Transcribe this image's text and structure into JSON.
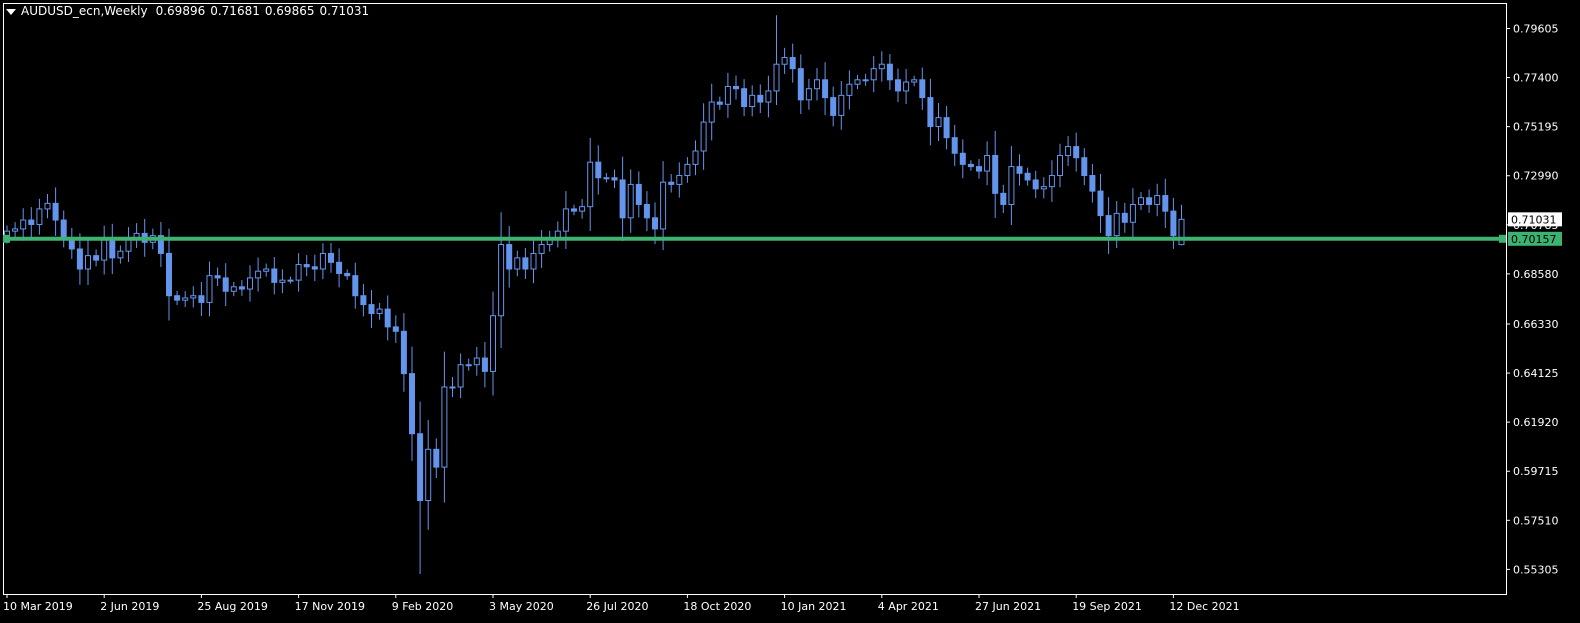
{
  "header": {
    "symbol": "AUDUSD_ecn,Weekly",
    "open": "0.69896",
    "high": "0.71681",
    "low": "0.69865",
    "close": "0.71031"
  },
  "colors": {
    "background": "#000000",
    "axis": "#ffffff",
    "candle": "#6495ed",
    "hline": "#3cb371",
    "price_label_bg": "#ffffff",
    "hline_label_bg": "#3cb371"
  },
  "icons": {
    "menu": "triangle-down-icon"
  },
  "chart_data": {
    "type": "candlestick",
    "title": "AUDUSD_ecn,Weekly",
    "timeframe": "Weekly",
    "ylim": [
      0.542,
      0.8075
    ],
    "y_ticks": [
      "0.79605",
      "0.77400",
      "0.75195",
      "0.72990",
      "0.70785",
      "0.68580",
      "0.66330",
      "0.64125",
      "0.61920",
      "0.59715",
      "0.57510",
      "0.55305"
    ],
    "x_ticks": [
      {
        "label": "10 Mar 2019",
        "bar": 0
      },
      {
        "label": "2 Jun 2019",
        "bar": 12
      },
      {
        "label": "25 Aug 2019",
        "bar": 24
      },
      {
        "label": "17 Nov 2019",
        "bar": 36
      },
      {
        "label": "9 Feb 2020",
        "bar": 48
      },
      {
        "label": "3 May 2020",
        "bar": 60
      },
      {
        "label": "26 Jul 2020",
        "bar": 72
      },
      {
        "label": "18 Oct 2020",
        "bar": 84
      },
      {
        "label": "10 Jan 2021",
        "bar": 96
      },
      {
        "label": "4 Apr 2021",
        "bar": 108
      },
      {
        "label": "27 Jun 2021",
        "bar": 120
      },
      {
        "label": "19 Sep 2021",
        "bar": 132
      },
      {
        "label": "12 Dec 2021",
        "bar": 144
      }
    ],
    "current_price": "0.71031",
    "horizontal_line": "0.70157",
    "closes": [
      0.705,
      0.706,
      0.71,
      0.708,
      0.715,
      0.7175,
      0.71,
      0.702,
      0.697,
      0.688,
      0.694,
      0.692,
      0.701,
      0.693,
      0.696,
      0.702,
      0.704,
      0.7,
      0.703,
      0.695,
      0.676,
      0.674,
      0.675,
      0.676,
      0.673,
      0.685,
      0.684,
      0.678,
      0.68,
      0.679,
      0.684,
      0.687,
      0.688,
      0.682,
      0.683,
      0.683,
      0.69,
      0.689,
      0.688,
      0.695,
      0.691,
      0.686,
      0.685,
      0.676,
      0.672,
      0.668,
      0.67,
      0.662,
      0.66,
      0.641,
      0.614,
      0.584,
      0.607,
      0.599,
      0.635,
      0.635,
      0.645,
      0.645,
      0.648,
      0.642,
      0.667,
      0.699,
      0.688,
      0.693,
      0.688,
      0.695,
      0.699,
      0.702,
      0.705,
      0.715,
      0.714,
      0.716,
      0.736,
      0.729,
      0.729,
      0.728,
      0.711,
      0.726,
      0.717,
      0.711,
      0.706,
      0.727,
      0.726,
      0.73,
      0.735,
      0.741,
      0.754,
      0.763,
      0.762,
      0.77,
      0.769,
      0.761,
      0.766,
      0.763,
      0.768,
      0.78,
      0.783,
      0.778,
      0.764,
      0.769,
      0.773,
      0.765,
      0.757,
      0.766,
      0.771,
      0.773,
      0.773,
      0.778,
      0.78,
      0.773,
      0.768,
      0.772,
      0.773,
      0.765,
      0.752,
      0.756,
      0.747,
      0.74,
      0.735,
      0.734,
      0.732,
      0.739,
      0.722,
      0.717,
      0.734,
      0.731,
      0.728,
      0.724,
      0.725,
      0.73,
      0.739,
      0.743,
      0.738,
      0.73,
      0.723,
      0.712,
      0.703,
      0.713,
      0.709,
      0.717,
      0.72,
      0.717,
      0.721,
      0.714,
      0.703,
      0.7103
    ],
    "last_bar": {
      "open": 0.69896,
      "high": 0.71681,
      "low": 0.69865,
      "close": 0.71031
    }
  }
}
